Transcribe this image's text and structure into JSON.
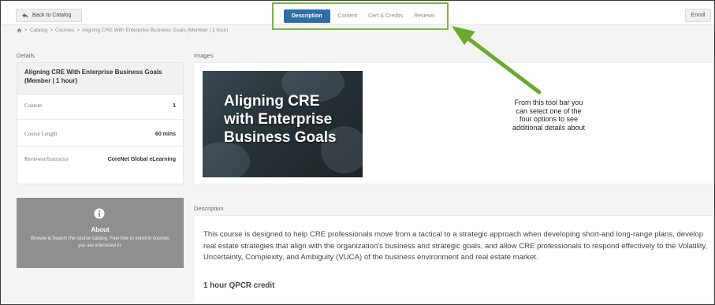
{
  "topbar": {
    "back_label": "Back to Catalog",
    "tabs": [
      {
        "label": "Description",
        "active": true
      },
      {
        "label": "Content",
        "active": false
      },
      {
        "label": "Cert & Credits",
        "active": false
      },
      {
        "label": "Reviews",
        "active": false
      }
    ],
    "enroll_label": "Enroll"
  },
  "breadcrumb": {
    "items": [
      "Catalog",
      "Courses",
      "Aligning CRE With Enterprise Business Goals (Member | 1 hour)"
    ],
    "separator": ">"
  },
  "details": {
    "section_label": "Details",
    "title": "Aligning CRE With Enterprise Business Goals (Member | 1 hour)",
    "rows": [
      {
        "key": "Content",
        "value": "1"
      },
      {
        "key": "Course Length",
        "value": "60 mins"
      },
      {
        "key": "Reviewer/Instructor",
        "value": "CoreNet Global eLearning"
      }
    ]
  },
  "images": {
    "section_label": "Images",
    "image_text": [
      "Aligning CRE",
      "with Enterprise",
      "Business Goals"
    ]
  },
  "callout": {
    "lines": [
      "From this tool bar you",
      "can select one of the",
      "four options to see",
      "additional details about"
    ],
    "arrow_color": "#6aab2e"
  },
  "about": {
    "icon": "info-icon",
    "title": "About",
    "text": "Browse & Search the course catalog. Feel free to enroll in courses you are interested in."
  },
  "description": {
    "section_label": "Description",
    "text": "This course is designed to help CRE professionals move from a tactical to a strategic approach when developing short-and long-range plans, develop real estate strategies that align with the organization's business and strategic goals, and allow CRE professionals to respond effectively to the Volatility, Uncertainty, Complexity, and Ambiguity (VUCA) of the business environment and real estate market.",
    "credit": "1 hour QPCR credit"
  },
  "colors": {
    "accent": "#2e6ea5",
    "highlight_box": "#79b742",
    "about_bg": "#8f8f8f"
  }
}
